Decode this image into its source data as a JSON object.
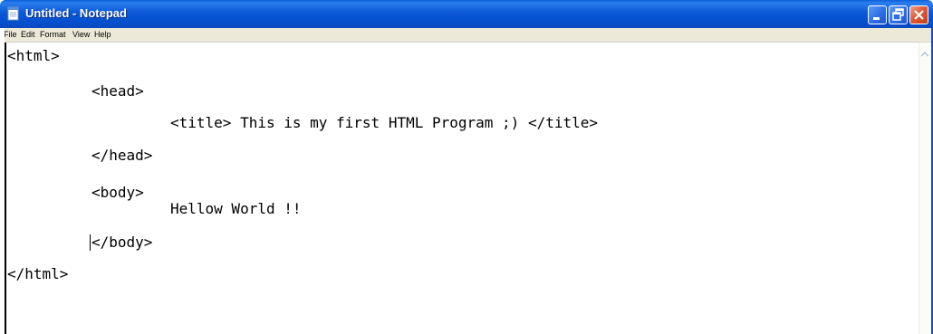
{
  "window": {
    "title": "Untitled - Notepad",
    "app_icon": "notepad-icon"
  },
  "caption_buttons": {
    "minimize": "minimize-icon",
    "maximize": "restore-icon",
    "close": "close-icon"
  },
  "menu": {
    "items": [
      {
        "label": "File"
      },
      {
        "label": "Edit"
      },
      {
        "label": "Format"
      },
      {
        "label": "View"
      },
      {
        "label": "Help"
      }
    ]
  },
  "editor": {
    "lines": [
      "<html>",
      "<head>",
      "<title> This is my first HTML Program ;) </title>",
      "</head>",
      "<body>",
      "Hellow World !!",
      "</body>",
      "</html>"
    ]
  },
  "colors": {
    "titlebar": "#0b58d6",
    "menubar": "#ece9d8",
    "close_button": "#e05a3a"
  }
}
